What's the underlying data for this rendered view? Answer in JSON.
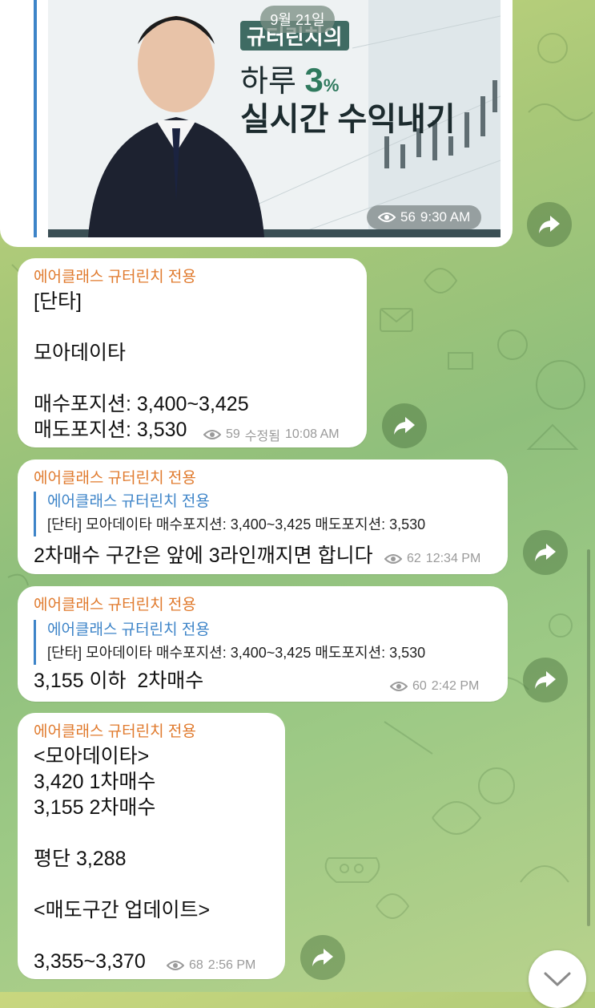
{
  "photo_post": {
    "date": "9월 21일",
    "banner_top": "규터린치의",
    "banner_line1_pre": "하루 ",
    "banner_line1_num": "3",
    "banner_line1_pct": "%",
    "banner_line2": "실시간 수익내기",
    "views": "56",
    "time": "9:30 AM"
  },
  "messages": [
    {
      "sender": "에어클래스 규터린치 전용",
      "text": "[단타]\n\n모아데이타\n\n매수포지션: 3,400~3,425\n매도포지션: 3,530",
      "views": "59",
      "edited": "수정됨",
      "time": "10:08 AM"
    },
    {
      "sender": "에어클래스 규터린치 전용",
      "reply_name": "에어클래스 규터린치 전용",
      "reply_text": "[단타] 모아데이타 매수포지션: 3,400~3,425 매도포지션: 3,530",
      "text": "2차매수 구간은 앞에 3라인깨지면 합니다",
      "views": "62",
      "time": "12:34 PM"
    },
    {
      "sender": "에어클래스 규터린치 전용",
      "reply_name": "에어클래스 규터린치 전용",
      "reply_text": "[단타] 모아데이타 매수포지션: 3,400~3,425 매도포지션: 3,530",
      "text": "3,155 이하  2차매수",
      "views": "60",
      "time": "2:42 PM"
    },
    {
      "sender": "에어클래스 규터린치 전용",
      "text": "<모아데이타>\n3,420 1차매수\n3,155 2차매수\n\n평단 3,288\n\n<매도구간 업데이트>\n\n3,355~3,370",
      "views": "68",
      "time": "2:56 PM"
    }
  ],
  "icons": {
    "share": "share-arrow-icon",
    "views": "eye-icon",
    "scroll_down": "chevron-down-icon"
  },
  "colors": {
    "sender": "#e07a2d",
    "reply_accent": "#3d84c8",
    "meta": "#9a9a9a"
  }
}
